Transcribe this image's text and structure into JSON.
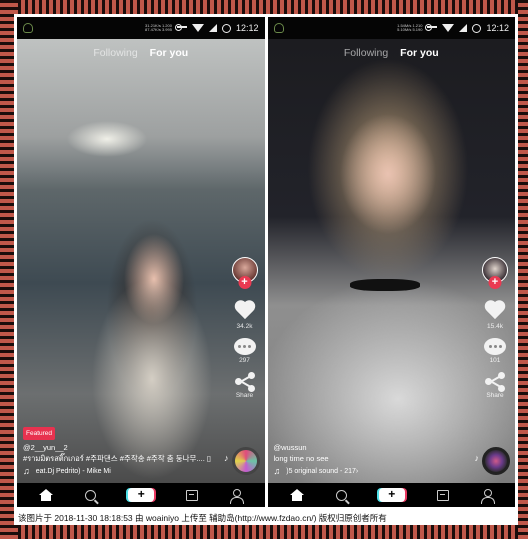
{
  "phones": [
    {
      "status_bar": {
        "net_speed_line1": "31.21K/s 1.200",
        "net_speed_line2": "87.47K/s 3.995",
        "time": "12:12"
      },
      "tabs": {
        "following": "Following",
        "for_you": "For you"
      },
      "actions": {
        "likes": "34.2k",
        "comments": "297",
        "share": "Share"
      },
      "caption": {
        "badge": "Featured",
        "username": "@2__yun__2",
        "description": "#รามมิตรสติ๊กเกอร์ #주파댄스 #주작송 #주작 춤 둥나무.... ▯",
        "sound": "eat.Dj Pedrito) - Mike Mi"
      }
    },
    {
      "status_bar": {
        "net_speed_line1": "1.54M/s 1.210",
        "net_speed_line2": "5.10M/s 5.190",
        "time": "12:12"
      },
      "tabs": {
        "following": "Following",
        "for_you": "For you"
      },
      "actions": {
        "likes": "15.4k",
        "comments": "101",
        "share": "Share"
      },
      "caption": {
        "username": "@wussun",
        "description": "long time no see",
        "sound": ")5   original sound - 217›"
      }
    }
  ],
  "nav": {
    "create": "+"
  },
  "watermark": "该图片于 2018-11-30 18:18:53 由 woainiyo 上传至 辅助岛(http://www.fzdao.cn/) 版权归原创者所有",
  "colors": {
    "frame": "#c0584a",
    "accent_red": "#e8324f",
    "cyan_glitch": "#4fe0e8"
  }
}
